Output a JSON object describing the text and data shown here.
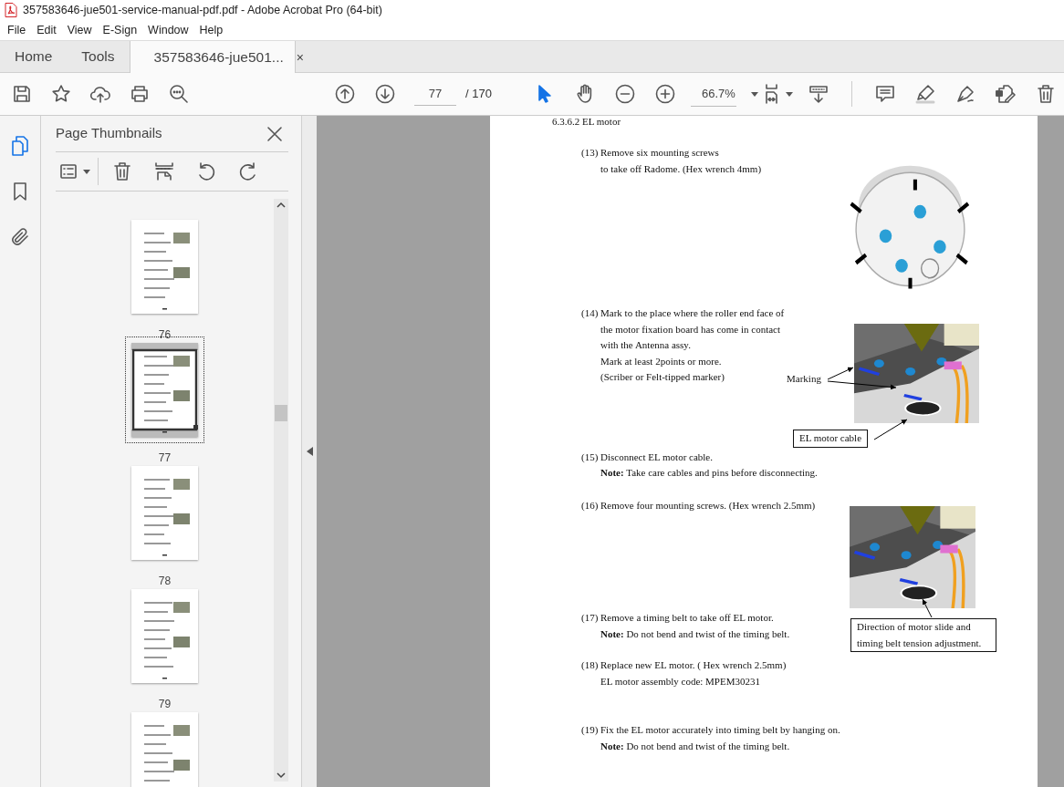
{
  "window": {
    "title": "357583646-jue501-service-manual-pdf.pdf - Adobe Acrobat Pro (64-bit)"
  },
  "menu": [
    "File",
    "Edit",
    "View",
    "E-Sign",
    "Window",
    "Help"
  ],
  "tabs": [
    {
      "label": "Home",
      "selected": false
    },
    {
      "label": "Tools",
      "selected": false
    },
    {
      "label": "357583646-jue501...",
      "selected": true,
      "close": "×"
    }
  ],
  "toolbar": {
    "page": "77",
    "page_total": "/ 170",
    "zoom": "66.7%"
  },
  "left_rail": [
    {
      "kind": "pages",
      "selected": true
    },
    {
      "kind": "bookmarks",
      "selected": false
    },
    {
      "kind": "attachments",
      "selected": false
    }
  ],
  "thumbnails_panel": {
    "title": "Page Thumbnails",
    "pages": [
      {
        "label": "76",
        "selected": false
      },
      {
        "label": "77",
        "selected": true
      },
      {
        "label": "78",
        "selected": false
      },
      {
        "label": "79",
        "selected": false
      },
      {
        "selected": false
      }
    ]
  },
  "document": {
    "heading": "6.3.6.2 EL motor",
    "steps": [
      {
        "number": "(13)",
        "lines": [
          "Remove six mounting screws",
          "to take off Radome. (Hex wrench 4mm)"
        ],
        "figure": {
          "kind": "picture"
        }
      },
      {
        "number": "(14)",
        "lines": [
          "Mark to the place where the roller end face of",
          "the motor fixation board has come in contact",
          "with the Antenna assy.",
          "Mark at least 2points or more.",
          "(Scriber or Felt-tipped marker)"
        ],
        "figure": {
          "kind": "picture"
        }
      },
      {
        "number": "(15)",
        "lines": [
          "Disconnect EL motor cable.",
          "**Note:** Take care cables and pins before disconnecting."
        ]
      },
      {
        "number": "(16)",
        "lines": [
          "Remove four mounting screws. (Hex wrench 2.5mm)"
        ],
        "figure": {
          "kind": "picture"
        }
      },
      {
        "number": "(17)",
        "lines": [
          "Remove a timing belt to take off EL motor.",
          "**Note:** Do not bend and twist of the timing belt."
        ]
      },
      {
        "number": "(18)",
        "lines": [
          "Replace new EL motor. ( Hex wrench 2.5mm)",
          "EL motor assembly code: MPEM30231"
        ]
      },
      {
        "number": "(19)",
        "lines": [
          "Fix the EL motor accurately into timing belt by hanging on.",
          "**Note:** Do not bend and twist of the timing belt."
        ]
      }
    ],
    "callouts": [
      {
        "kind": "label",
        "text": "Marking"
      },
      {
        "kind": "box",
        "text": "EL motor cable"
      },
      {
        "kind": "box",
        "text": "Direction of motor slide and timing belt tension adjustment."
      }
    ]
  }
}
